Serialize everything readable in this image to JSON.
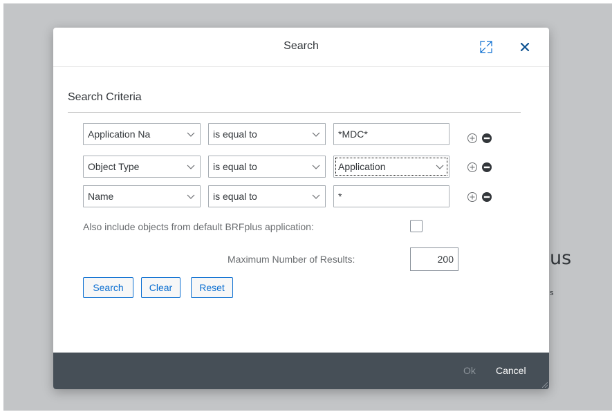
{
  "background": {
    "text_fragment_1": "us",
    "text_fragment_2": "s"
  },
  "dialog": {
    "title": "Search",
    "header_icons": [
      "fullscreen-icon",
      "close-icon"
    ]
  },
  "criteria": {
    "section_title": "Search Criteria",
    "rows": [
      {
        "field": "Application Na",
        "operator": "is equal to",
        "value": "*MDC*",
        "value_type": "text"
      },
      {
        "field": "Object Type",
        "operator": "is equal to",
        "value": "Application",
        "value_type": "select"
      },
      {
        "field": "Name",
        "operator": "is equal to",
        "value": "*",
        "value_type": "text"
      }
    ],
    "include_default_label": "Also include objects from default BRFplus application:",
    "include_default_checked": false,
    "max_results_label": "Maximum Number of Results:",
    "max_results_value": "200"
  },
  "buttons": {
    "search": "Search",
    "clear": "Clear",
    "reset": "Reset"
  },
  "footer": {
    "ok": "Ok",
    "cancel": "Cancel"
  },
  "colors": {
    "accent": "#0a6ed1",
    "footer_bg": "#464f57",
    "remove_icon": "#32363a"
  }
}
